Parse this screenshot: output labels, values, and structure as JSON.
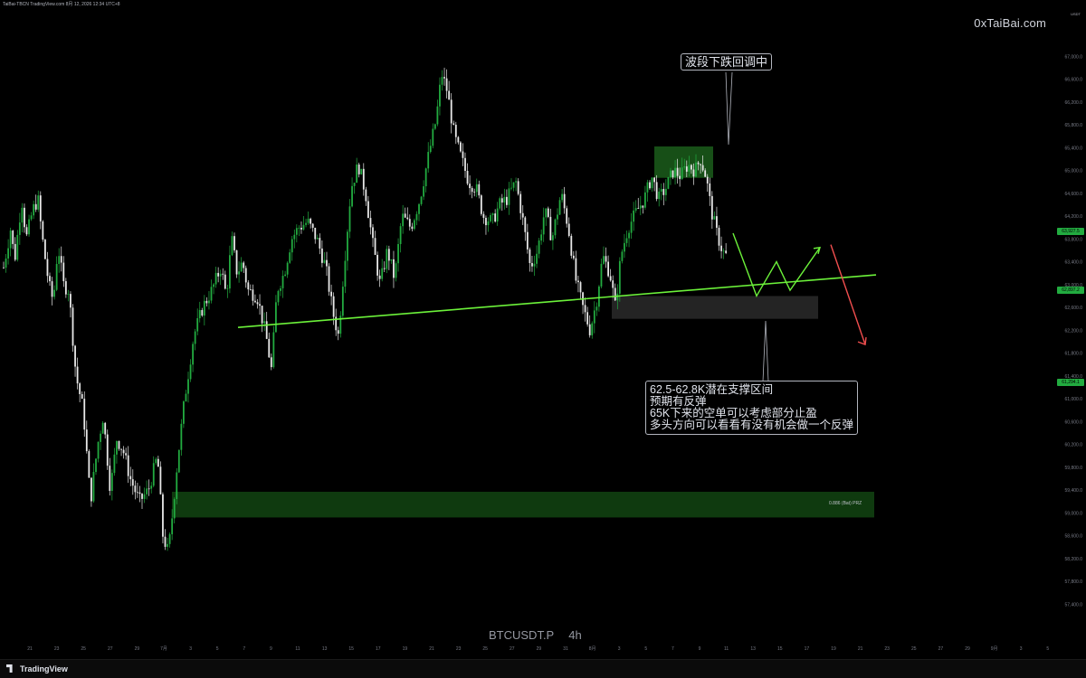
{
  "header": {
    "info": "TaiBai-TBCN TradingView.com 8月 12, 2026 12:34 UTC+8",
    "watermark": "0xTaiBai.com",
    "currency": "USDT"
  },
  "symbol": {
    "ticker": "BTCUSDT.P",
    "interval": "4h"
  },
  "annotations": {
    "top_note": "波段下跌回调中",
    "support_note": "62.5-62.8K潜在支撑区间\n预期有反弹\n65K下来的空单可以考虑部分止盈\n多头方向可以看看有没有机会做一个反弹",
    "prz_label": "0.886 (Bat) PRZ"
  },
  "price_badges": [
    {
      "price": 63927.5,
      "label": "63,927.5",
      "color": "#22ab40"
    },
    {
      "price": 62897.2,
      "label": "62,897.2",
      "color": "#22ab40"
    },
    {
      "price": 61294.1,
      "label": "61,294.1",
      "color": "#22ab40"
    }
  ],
  "colors": {
    "bull": "#22ab40",
    "bear": "#e8e8e8",
    "trend": "#6cf23a",
    "path_up": "#6cf23a",
    "path_down": "#f04e4e",
    "zone_green": "#0f3a0f",
    "zone_grey": "#2a2a2a"
  },
  "footer": {
    "brand": "TradingView"
  },
  "chart_data": {
    "type": "candlestick",
    "ylim": [
      57200,
      67400
    ],
    "y_ticks": [
      "67,000.0",
      "66,600.0",
      "66,200.0",
      "65,800.0",
      "65,400.0",
      "65,000.0",
      "64,600.0",
      "64,200.0",
      "63,800.0",
      "63,400.0",
      "63,000.0",
      "62,600.0",
      "62,200.0",
      "61,800.0",
      "61,400.0",
      "61,000.0",
      "60,600.0",
      "60,200.0",
      "59,800.0",
      "59,400.0",
      "59,000.0",
      "58,600.0",
      "58,200.0",
      "57,800.0",
      "57,400.0"
    ],
    "x_ticks": [
      "21",
      "23",
      "25",
      "27",
      "29",
      "7月",
      "3",
      "5",
      "7",
      "9",
      "11",
      "13",
      "15",
      "17",
      "19",
      "21",
      "23",
      "25",
      "27",
      "29",
      "31",
      "8月",
      "3",
      "5",
      "7",
      "9",
      "11",
      "13",
      "15",
      "17",
      "19",
      "21",
      "23",
      "25",
      "27",
      "29",
      "9月",
      "3",
      "5"
    ],
    "keypoints": [
      [
        0,
        63300
      ],
      [
        8,
        64000
      ],
      [
        12,
        63400
      ],
      [
        20,
        64500
      ],
      [
        25,
        63800
      ],
      [
        32,
        64300
      ],
      [
        38,
        64500
      ],
      [
        42,
        63900
      ],
      [
        50,
        63000
      ],
      [
        55,
        62700
      ],
      [
        60,
        63700
      ],
      [
        66,
        63000
      ],
      [
        72,
        62900
      ],
      [
        80,
        61400
      ],
      [
        88,
        60800
      ],
      [
        96,
        59200
      ],
      [
        104,
        60200
      ],
      [
        110,
        60700
      ],
      [
        118,
        59400
      ],
      [
        125,
        60300
      ],
      [
        132,
        60100
      ],
      [
        140,
        59600
      ],
      [
        150,
        59200
      ],
      [
        160,
        59400
      ],
      [
        170,
        60000
      ],
      [
        176,
        58600
      ],
      [
        182,
        58300
      ],
      [
        186,
        58900
      ],
      [
        192,
        59900
      ],
      [
        200,
        61000
      ],
      [
        210,
        62100
      ],
      [
        220,
        62600
      ],
      [
        230,
        62900
      ],
      [
        240,
        63300
      ],
      [
        246,
        62800
      ],
      [
        252,
        63800
      ],
      [
        258,
        63200
      ],
      [
        264,
        63400
      ],
      [
        270,
        62900
      ],
      [
        280,
        62800
      ],
      [
        290,
        62100
      ],
      [
        296,
        61500
      ],
      [
        302,
        62900
      ],
      [
        310,
        63200
      ],
      [
        318,
        63800
      ],
      [
        326,
        64000
      ],
      [
        336,
        64100
      ],
      [
        346,
        63800
      ],
      [
        356,
        63300
      ],
      [
        364,
        62500
      ],
      [
        370,
        62100
      ],
      [
        376,
        63300
      ],
      [
        384,
        64700
      ],
      [
        392,
        65100
      ],
      [
        400,
        64600
      ],
      [
        408,
        63700
      ],
      [
        416,
        63000
      ],
      [
        424,
        63600
      ],
      [
        432,
        63100
      ],
      [
        440,
        64200
      ],
      [
        450,
        64000
      ],
      [
        460,
        64500
      ],
      [
        470,
        65300
      ],
      [
        478,
        65900
      ],
      [
        484,
        66700
      ],
      [
        490,
        66400
      ],
      [
        498,
        65600
      ],
      [
        506,
        65200
      ],
      [
        514,
        64800
      ],
      [
        522,
        64700
      ],
      [
        530,
        64200
      ],
      [
        540,
        64100
      ],
      [
        548,
        64400
      ],
      [
        556,
        64500
      ],
      [
        566,
        64800
      ],
      [
        574,
        64100
      ],
      [
        582,
        63300
      ],
      [
        590,
        63600
      ],
      [
        598,
        64300
      ],
      [
        606,
        63800
      ],
      [
        616,
        64600
      ],
      [
        624,
        64000
      ],
      [
        632,
        63100
      ],
      [
        640,
        62600
      ],
      [
        648,
        62200
      ],
      [
        655,
        62700
      ],
      [
        662,
        63500
      ],
      [
        670,
        63200
      ],
      [
        676,
        62600
      ],
      [
        682,
        63500
      ],
      [
        690,
        64000
      ],
      [
        700,
        64300
      ],
      [
        708,
        64500
      ],
      [
        716,
        64900
      ],
      [
        724,
        64500
      ],
      [
        732,
        64700
      ],
      [
        740,
        65000
      ],
      [
        748,
        64900
      ],
      [
        756,
        65100
      ],
      [
        764,
        65000
      ],
      [
        770,
        65200
      ],
      [
        776,
        64900
      ],
      [
        782,
        64300
      ],
      [
        788,
        63900
      ],
      [
        794,
        63600
      ],
      [
        798,
        63500
      ],
      [
        804,
        63927
      ]
    ],
    "candle_range_x": [
      4,
      804
    ],
    "zones": [
      {
        "name": "support_zone",
        "y_top": 62800,
        "y_bottom": 62400
      },
      {
        "name": "prz_zone",
        "y_top": 59370,
        "y_bottom": 58920
      },
      {
        "name": "resistance_box",
        "y_top": 65420,
        "y_bottom": 64870
      }
    ],
    "trendline": [
      [
        62250,
        61700
      ],
      [
        63170,
        61700
      ]
    ],
    "projection_path": [
      63900,
      62800,
      63400,
      62900,
      63650
    ],
    "down_arrow": [
      63700,
      61950
    ]
  }
}
